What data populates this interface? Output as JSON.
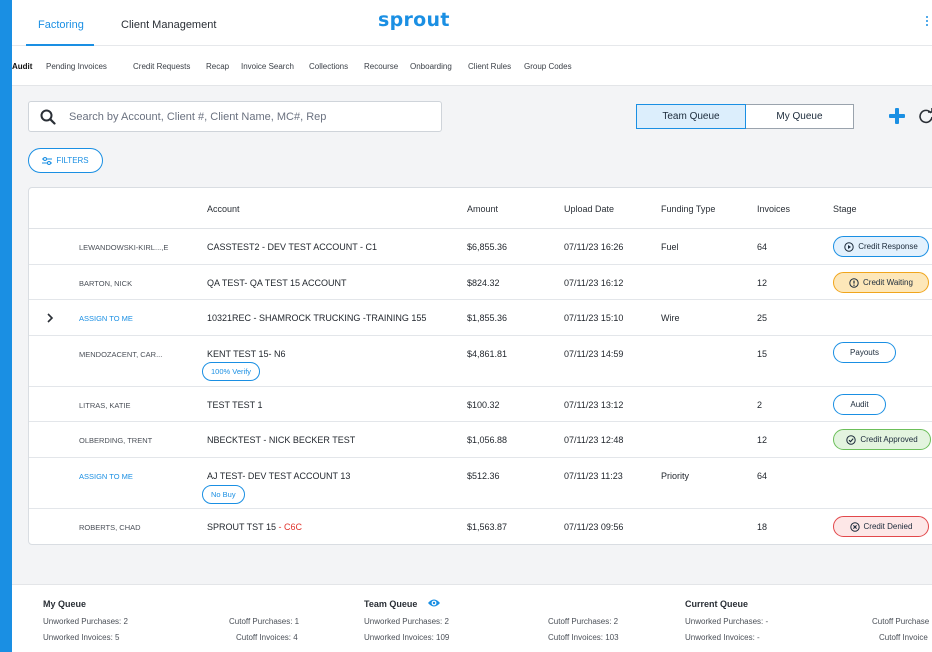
{
  "header": {
    "tabs": [
      {
        "label": "Factoring",
        "active": true
      },
      {
        "label": "Client Management",
        "active": false
      }
    ],
    "logo": "sprout",
    "accent_color": "#1a8fe3"
  },
  "subnav": [
    "Audit",
    "Pending Invoices",
    "Credit Requests",
    "Recap",
    "Invoice Search",
    "Collections",
    "Recourse",
    "Onboarding",
    "Client Rules",
    "Group Codes"
  ],
  "search": {
    "placeholder": "Search by Account, Client #, Client Name, MC#, Rep",
    "value": ""
  },
  "queue": {
    "team": "Team Queue",
    "mine": "My Queue",
    "selected": "Team Queue"
  },
  "filters_label": "FILTERS",
  "table": {
    "columns": [
      "Account",
      "Amount",
      "Upload Date",
      "Funding Type",
      "Invoices",
      "Stage"
    ],
    "rows": [
      {
        "rep": "LEWANDOWSKI-KIRL...,E",
        "account": "CASSTEST2 - DEV TEST ACCOUNT - C1",
        "amount": "$6,855.36",
        "date": "07/11/23 16:26",
        "funding": "Fuel",
        "invoices": "64",
        "stage": "Credit Response"
      },
      {
        "rep": "BARTON, NICK",
        "account": "QA TEST- QA TEST 15 ACCOUNT",
        "amount": "$824.32",
        "date": "07/11/23 16:12",
        "funding": "",
        "invoices": "12",
        "stage": "Credit Waiting"
      },
      {
        "rep": "ASSIGN TO ME",
        "account": "10321REC - SHAMROCK TRUCKING -TRAINING 155",
        "amount": "$1,855.36",
        "date": "07/11/23 15:10",
        "funding": "Wire",
        "invoices": "25",
        "stage": ""
      },
      {
        "rep": "MENDOZACENT, CAR...",
        "account": "KENT TEST 15- N6",
        "tag": "100% Verify",
        "amount": "$4,861.81",
        "date": "07/11/23 14:59",
        "funding": "",
        "invoices": "15",
        "stage": "Payouts"
      },
      {
        "rep": "LITRAS, KATIE",
        "account": "TEST TEST 1",
        "amount": "$100.32",
        "date": "07/11/23 13:12",
        "funding": "",
        "invoices": "2",
        "stage": "Audit"
      },
      {
        "rep": "OLBERDING, TRENT",
        "account": "NBECKTEST - NICK BECKER TEST",
        "amount": "$1,056.88",
        "date": "07/11/23 12:48",
        "funding": "",
        "invoices": "12",
        "stage": "Credit Approved"
      },
      {
        "rep": "ASSIGN TO ME",
        "account": "AJ TEST- DEV TEST ACCOUNT 13",
        "tag": "No Buy",
        "amount": "$512.36",
        "date": "07/11/23 11:23",
        "funding": "Priority",
        "invoices": "64",
        "stage": ""
      },
      {
        "rep": "ROBERTS, CHAD",
        "account": "SPROUT TST 15",
        "account_suffix": " - C6C",
        "amount": "$1,563.87",
        "date": "07/11/23 09:56",
        "funding": "",
        "invoices": "18",
        "stage": "Credit Denied"
      }
    ]
  },
  "footer": {
    "my_queue": {
      "title": "My Queue",
      "unworked_purchases": "Unworked Purchases: 2",
      "unworked_invoices": "Unworked Invoices: 5",
      "cutoff_purchases": "Cutoff Purchases: 1",
      "cutoff_invoices": "Cutoff Invoices: 4"
    },
    "team_queue": {
      "title": "Team Queue",
      "unworked_purchases": "Unworked Purchases: 2",
      "unworked_invoices": "Unworked Invoices: 109",
      "cutoff_purchases": "Cutoff Purchases: 2",
      "cutoff_invoices": "Cutoff Invoices: 103"
    },
    "current_queue": {
      "title": "Current Queue",
      "unworked_purchases": "Unworked Purchases: -",
      "unworked_invoices": "Unworked Invoices: -",
      "cutoff_purchases": "Cutoff Purchase",
      "cutoff_invoices": "Cutoff Invoice"
    }
  }
}
